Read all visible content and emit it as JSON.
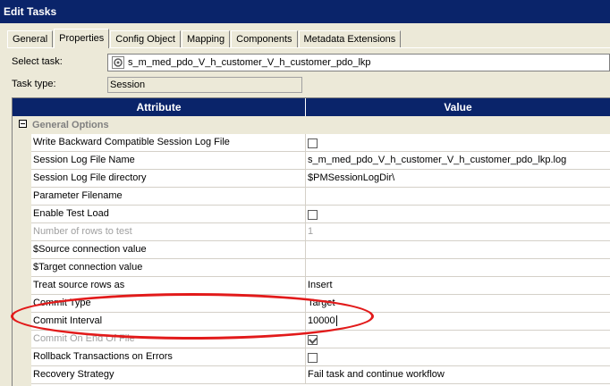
{
  "window": {
    "title": "Edit Tasks"
  },
  "tabs": [
    "General",
    "Properties",
    "Config Object",
    "Mapping",
    "Components",
    "Metadata Extensions"
  ],
  "active_tab": "Properties",
  "select_task": {
    "label": "Select task:",
    "value": "s_m_med_pdo_V_h_customer_V_h_customer_pdo_lkp",
    "icon": "session-icon"
  },
  "task_type": {
    "label": "Task type:",
    "value": "Session"
  },
  "grid": {
    "header_attribute": "Attribute",
    "header_value": "Value",
    "group_name": "General Options",
    "rows": [
      {
        "attr": "Write Backward Compatible Session Log File",
        "value": "",
        "kind": "checkbox",
        "checked": false,
        "disabled": false
      },
      {
        "attr": "Session Log File Name",
        "value": "s_m_med_pdo_V_h_customer_V_h_customer_pdo_lkp.log",
        "kind": "text",
        "disabled": false
      },
      {
        "attr": "Session Log File directory",
        "value": "$PMSessionLogDir\\",
        "kind": "text",
        "disabled": false
      },
      {
        "attr": "Parameter Filename",
        "value": "",
        "kind": "text",
        "disabled": false
      },
      {
        "attr": "Enable Test Load",
        "value": "",
        "kind": "checkbox",
        "checked": false,
        "disabled": false
      },
      {
        "attr": "Number of rows to test",
        "value": "1",
        "kind": "text",
        "disabled": true
      },
      {
        "attr": "$Source connection value",
        "value": "",
        "kind": "text",
        "disabled": false
      },
      {
        "attr": "$Target connection value",
        "value": "",
        "kind": "text",
        "disabled": false
      },
      {
        "attr": "Treat source rows as",
        "value": "Insert",
        "kind": "text",
        "disabled": false
      },
      {
        "attr": "Commit Type",
        "value": "Target",
        "kind": "text",
        "disabled": false
      },
      {
        "attr": "Commit Interval",
        "value": "10000",
        "kind": "edit",
        "disabled": false
      },
      {
        "attr": "Commit On End Of File",
        "value": "",
        "kind": "checkbox",
        "checked": true,
        "disabled": true
      },
      {
        "attr": "Rollback Transactions on Errors",
        "value": "",
        "kind": "checkbox",
        "checked": false,
        "disabled": false
      },
      {
        "attr": "Recovery Strategy",
        "value": "Fail task and continue workflow",
        "kind": "text",
        "disabled": false
      }
    ]
  },
  "highlight_color": "#e21a1a"
}
